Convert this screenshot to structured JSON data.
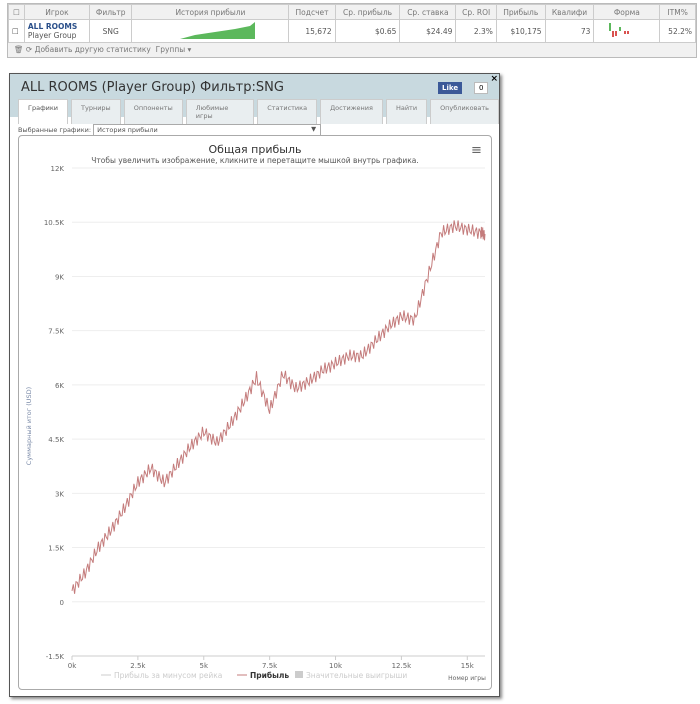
{
  "table": {
    "headers": [
      "Игрок",
      "Фильтр",
      "История прибыли",
      "Подсчет",
      "Ср. прибыль",
      "Ср. ставка",
      "Ср. ROI",
      "Прибыль",
      "Квалифи",
      "Форма",
      "ITM%"
    ],
    "row": {
      "player": "ALL ROOMS",
      "group": "Player Group",
      "filter": "SNG",
      "count": "15,672",
      "avg_profit": "$0.65",
      "avg_stake": "$24.49",
      "avg_roi": "2.3%",
      "profit": "$10,175",
      "qual": "73",
      "itm": "52.2%"
    },
    "footer": {
      "add_stat": "Добавить другую статистику",
      "groups": "Группы ▾"
    }
  },
  "window": {
    "title": "ALL ROOMS (Player Group) Фильтр:SNG",
    "like": "Like",
    "like_count": "0",
    "close": "×",
    "tabs": [
      "Графики",
      "Турниры",
      "Оппоненты",
      "Любимые игры",
      "Статистика",
      "Достижения",
      "Найти",
      "Опубликовать"
    ],
    "selector_label": "Выбранные графики:",
    "selector_value": "История прибыли"
  },
  "colors": {
    "line": "#c47c7c",
    "header": "#c8d9df",
    "sparkline": "#5cb85c"
  },
  "chart_data": {
    "type": "line",
    "title": "Общая прибыль",
    "subtitle": "Чтобы увеличить изображение, кликните и перетащите мышкой внутрь графика.",
    "xlabel": "Номер игры",
    "ylabel": "Суммарный итог (USD)",
    "xlim": [
      0,
      15672
    ],
    "ylim": [
      -1500,
      12000
    ],
    "xticks": [
      "0k",
      "2.5k",
      "5k",
      "7.5k",
      "10k",
      "12.5k",
      "15k"
    ],
    "yticks": [
      "12K",
      "10.5K",
      "9K",
      "7.5K",
      "6K",
      "4.5K",
      "3K",
      "1.5K",
      "0",
      "-1.5K"
    ],
    "legend": [
      "Прибыль за минусом рейка",
      "Прибыль",
      "Значительные выигрыши"
    ],
    "series": [
      {
        "name": "Прибыль",
        "x": [
          0,
          500,
          1000,
          1500,
          2000,
          2500,
          3000,
          3500,
          4000,
          4500,
          5000,
          5500,
          6000,
          6500,
          7000,
          7500,
          8000,
          8500,
          9000,
          9500,
          10000,
          10500,
          11000,
          11500,
          12000,
          12500,
          13000,
          13500,
          14000,
          14500,
          15000,
          15500,
          15672
        ],
        "y": [
          300,
          800,
          1500,
          2000,
          2600,
          3300,
          3700,
          3300,
          3800,
          4300,
          4700,
          4400,
          4900,
          5500,
          6200,
          5300,
          6300,
          5900,
          6100,
          6400,
          6600,
          6800,
          6800,
          7200,
          7600,
          7900,
          7800,
          9000,
          10200,
          10400,
          10300,
          10200,
          10175
        ]
      }
    ]
  }
}
